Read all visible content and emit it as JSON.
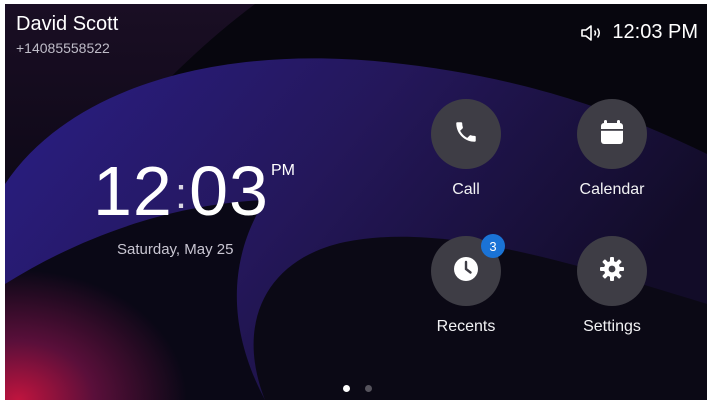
{
  "user": {
    "name": "David Scott",
    "number": "+14085558522"
  },
  "status_bar": {
    "time": "12:03 PM",
    "volume_icon": "speaker-volume-icon"
  },
  "clock": {
    "hours": "12",
    "separator": ":",
    "minutes": "03",
    "ampm": "PM",
    "date": "Saturday, May 25"
  },
  "tiles": [
    {
      "label": "Call",
      "icon": "phone-icon"
    },
    {
      "label": "Calendar",
      "icon": "calendar-icon"
    },
    {
      "label": "Recents",
      "icon": "clock-icon",
      "badge": "3"
    },
    {
      "label": "Settings",
      "icon": "gear-icon"
    }
  ],
  "pagination": {
    "active_page": 1,
    "total_pages": 2
  },
  "colors": {
    "tile_bg": "#3e3d45",
    "badge_bg": "#1a73d6",
    "active_dot": "#ffffff",
    "inactive_dot": "#55535c"
  }
}
